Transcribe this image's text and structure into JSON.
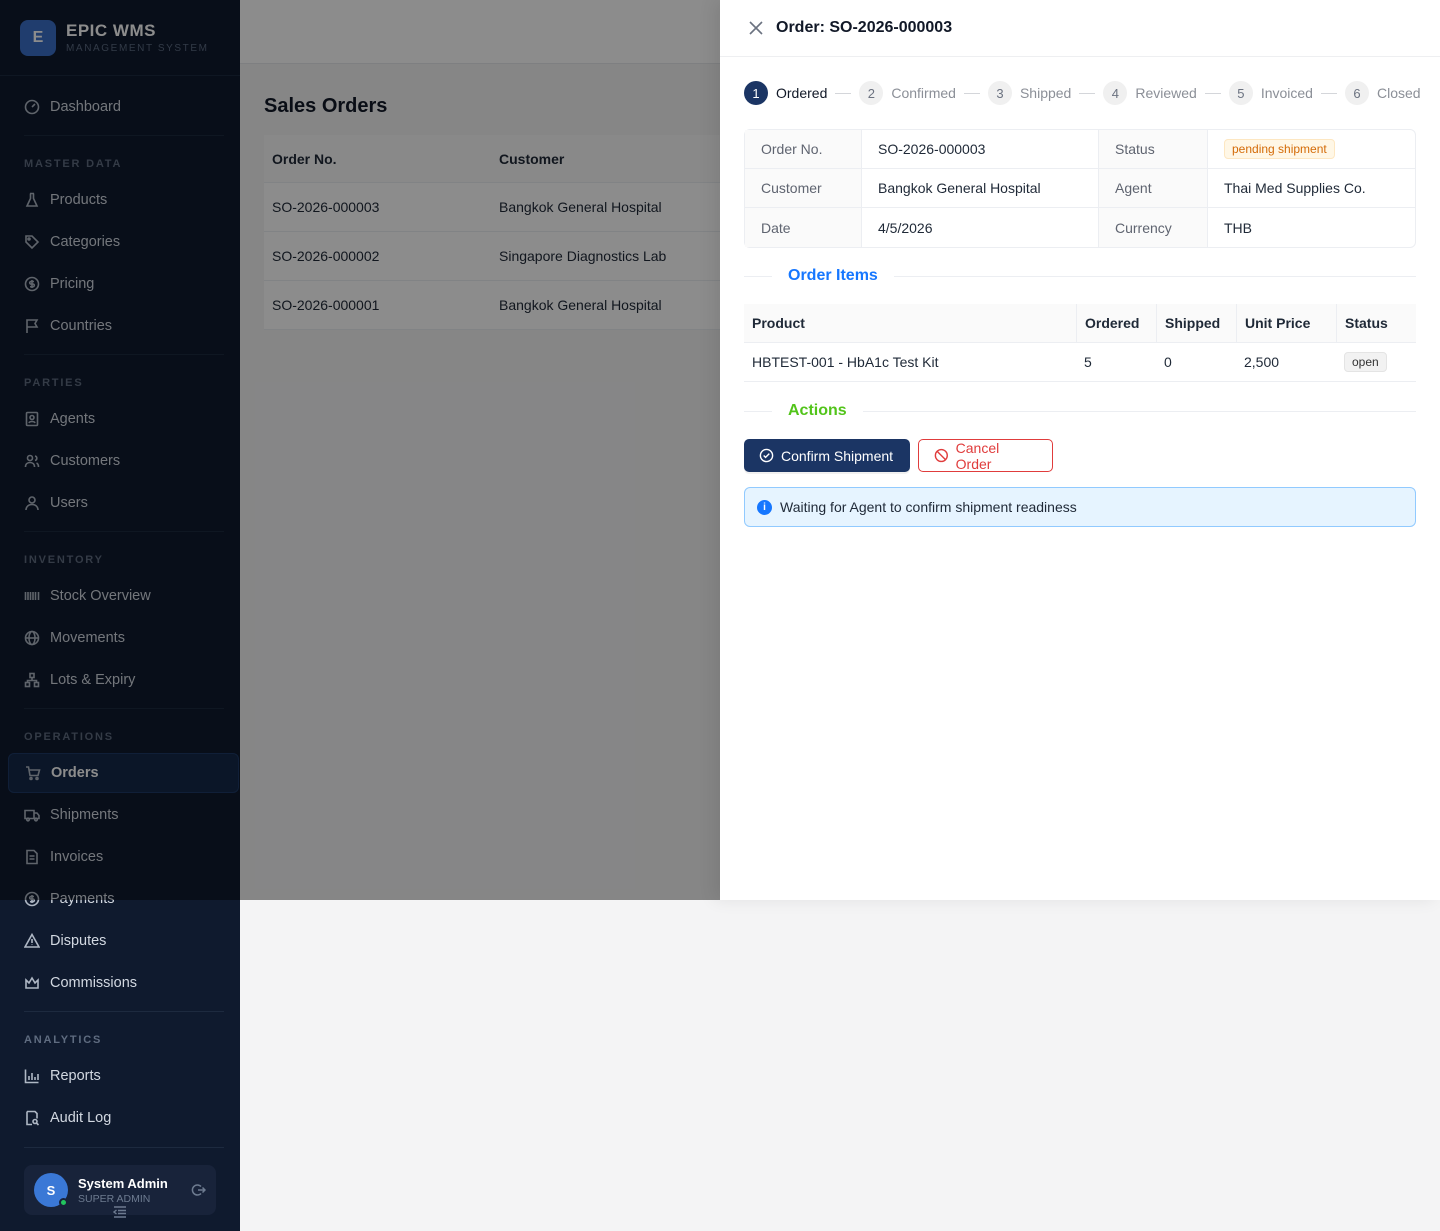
{
  "sidebar": {
    "brand": {
      "logo_letter": "E",
      "name": "EPIC WMS",
      "subtitle": "MANAGEMENT SYSTEM"
    },
    "dashboard": "Dashboard",
    "sections": {
      "master_data": "MASTER DATA",
      "parties": "PARTIES",
      "inventory": "INVENTORY",
      "operations": "OPERATIONS",
      "analytics": "ANALYTICS"
    },
    "items": {
      "products": "Products",
      "categories": "Categories",
      "pricing": "Pricing",
      "countries": "Countries",
      "agents": "Agents",
      "customers": "Customers",
      "users": "Users",
      "stock_overview": "Stock Overview",
      "movements": "Movements",
      "lots_expiry": "Lots & Expiry",
      "orders": "Orders",
      "shipments": "Shipments",
      "invoices": "Invoices",
      "payments": "Payments",
      "disputes": "Disputes",
      "commissions": "Commissions",
      "reports": "Reports",
      "audit_log": "Audit Log"
    },
    "active_item": "orders",
    "user": {
      "initial": "S",
      "name": "System Admin",
      "role": "SUPER ADMIN"
    }
  },
  "main": {
    "title": "Sales Orders",
    "columns": [
      "Order No.",
      "Customer"
    ],
    "rows": [
      [
        "SO-2026-000003",
        "Bangkok General Hospital"
      ],
      [
        "SO-2026-000002",
        "Singapore Diagnostics Lab"
      ],
      [
        "SO-2026-000001",
        "Bangkok General Hospital"
      ]
    ]
  },
  "drawer": {
    "title": "Order: SO-2026-000003",
    "steps": [
      {
        "num": "1",
        "label": "Ordered"
      },
      {
        "num": "2",
        "label": "Confirmed"
      },
      {
        "num": "3",
        "label": "Shipped"
      },
      {
        "num": "4",
        "label": "Reviewed"
      },
      {
        "num": "5",
        "label": "Invoiced"
      },
      {
        "num": "6",
        "label": "Closed"
      }
    ],
    "current_step": 1,
    "details": {
      "order_no_label": "Order No.",
      "order_no": "SO-2026-000003",
      "status_label": "Status",
      "status": "pending shipment",
      "customer_label": "Customer",
      "customer": "Bangkok General Hospital",
      "agent_label": "Agent",
      "agent": "Thai Med Supplies Co.",
      "date_label": "Date",
      "date": "4/5/2026",
      "currency_label": "Currency",
      "currency": "THB"
    },
    "order_items_title": "Order Items",
    "items_columns": [
      "Product",
      "Ordered",
      "Shipped",
      "Unit Price",
      "Status"
    ],
    "items": [
      {
        "product": "HBTEST-001 - HbA1c Test Kit",
        "ordered": "5",
        "shipped": "0",
        "unit_price": "2,500",
        "status": "open"
      }
    ],
    "actions_title": "Actions",
    "confirm_label": "Confirm Shipment",
    "cancel_label": "Cancel Order",
    "alert": "Waiting for Agent to confirm shipment readiness"
  },
  "colors": {
    "sidebar_bg": "#0f1a2e",
    "primary": "#1b3564",
    "danger": "#e03c3c",
    "order_items_title": "#1677ff",
    "actions_title": "#52c41a",
    "pending_tag": "#d46b08"
  }
}
